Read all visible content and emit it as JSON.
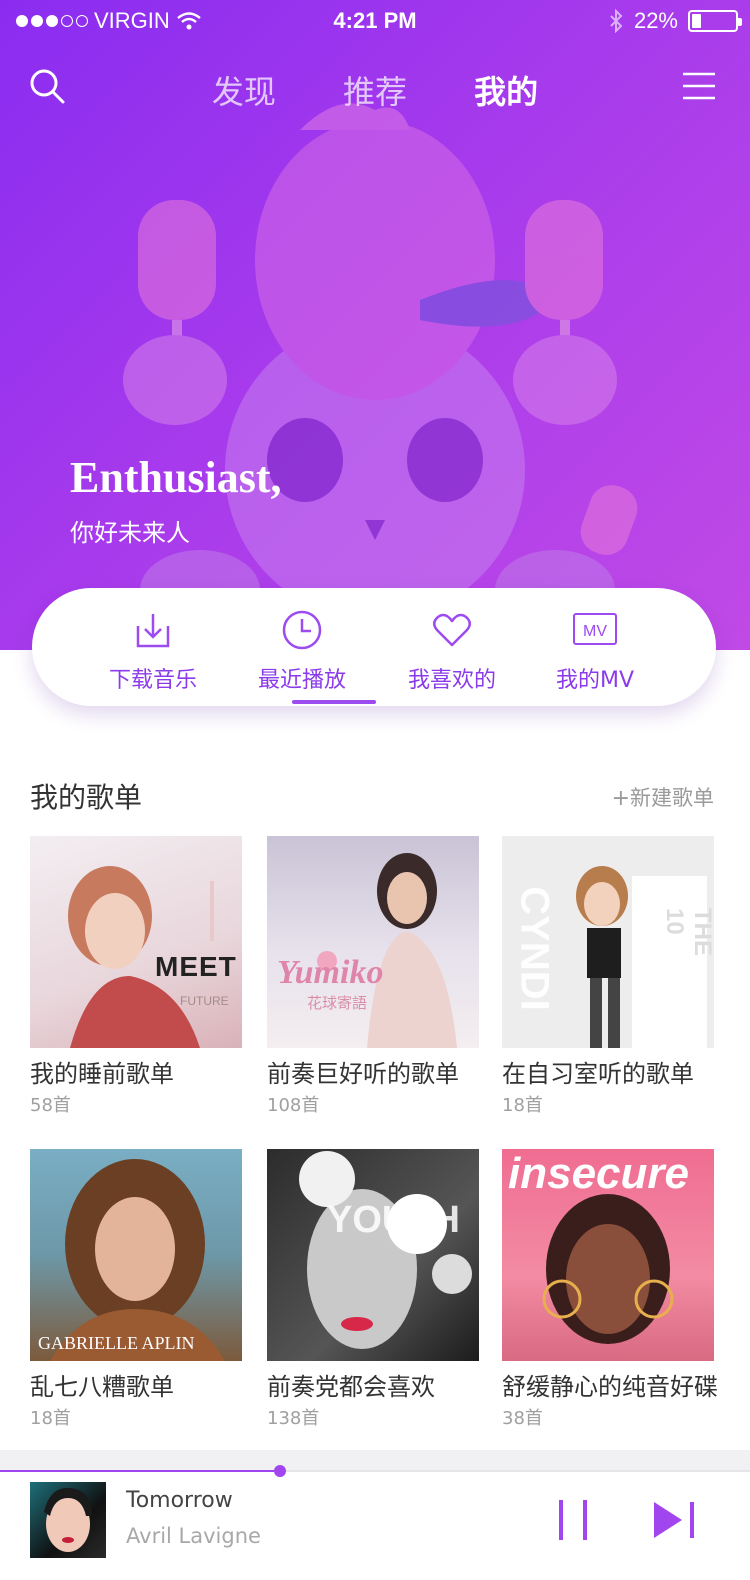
{
  "status_bar": {
    "carrier": "VIRGIN",
    "time": "4:21 PM",
    "battery": "22%",
    "battery_level": 0.22,
    "signal_bars_filled": 3,
    "signal_bars_total": 5
  },
  "nav": {
    "tabs": [
      {
        "label": "发现",
        "active": false
      },
      {
        "label": "推荐",
        "active": false
      },
      {
        "label": "我的",
        "active": true
      }
    ],
    "left_icon": "search-icon",
    "right_icon": "menu-icon"
  },
  "greeting": {
    "title": "Enthusiast,",
    "subtitle": "你好未来人"
  },
  "quick_actions": [
    {
      "label": "下载音乐",
      "icon": "download-icon",
      "active": false
    },
    {
      "label": "最近播放",
      "icon": "clock-icon",
      "active": true
    },
    {
      "label": "我喜欢的",
      "icon": "heart-icon",
      "active": false
    },
    {
      "label": "我的MV",
      "icon": "mv-icon",
      "icon_text": "MV",
      "active": false
    }
  ],
  "playlists": {
    "title": "我的歌单",
    "new_label": "新建歌单",
    "items": [
      {
        "title": "我的睡前歌单",
        "count": "58首",
        "cover_text": "MEET",
        "cover_sub": "FUTURE"
      },
      {
        "title": "前奏巨好听的歌单",
        "count": "108首",
        "cover_text": "Yumiko",
        "cover_sub": "花球寄語"
      },
      {
        "title": "在自习室听的歌单",
        "count": "18首",
        "cover_text": "CYNDI",
        "cover_sub": "THE 10"
      },
      {
        "title": "乱七八糟歌单",
        "count": "18首",
        "cover_text": "GABRIELLE APLIN",
        "cover_sub": ""
      },
      {
        "title": "前奏党都会喜欢",
        "count": "138首",
        "cover_text": "YOUTH",
        "cover_sub": ""
      },
      {
        "title": "舒缓静心的纯音好碟",
        "count": "38首",
        "cover_text": "insecure",
        "cover_sub": ""
      }
    ]
  },
  "player": {
    "track_title": "Tomorrow",
    "artist": "Avril Lavigne",
    "progress": 0.373
  },
  "colors": {
    "accent": "#9b4bf0",
    "hero_start": "#8a2cf0",
    "hero_end": "#c14ae6"
  }
}
